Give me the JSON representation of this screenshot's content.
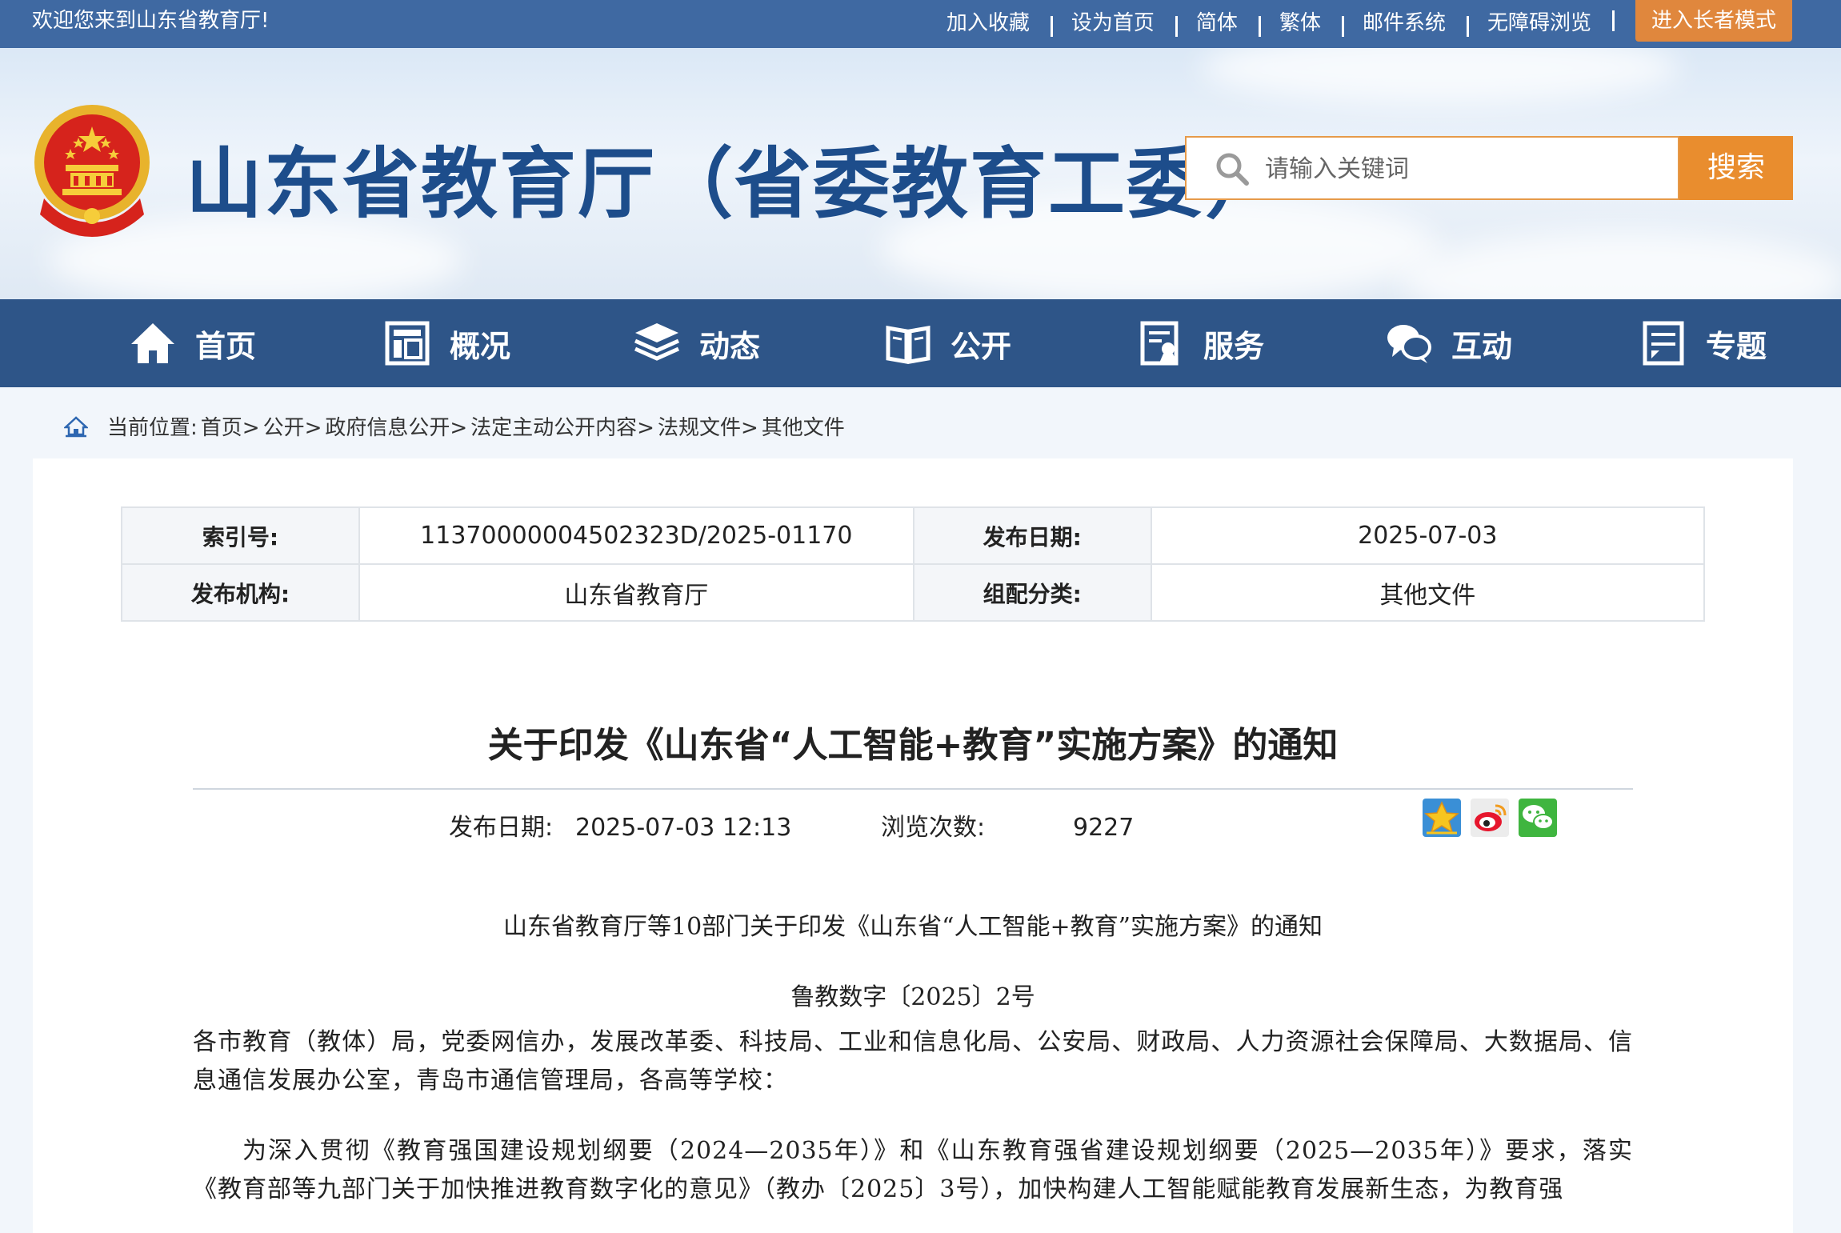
{
  "topbar": {
    "welcome": "欢迎您来到山东省教育厅!",
    "links": [
      "加入收藏",
      "设为首页",
      "简体",
      "繁体",
      "邮件系统",
      "无障碍浏览"
    ],
    "elder_mode": "进入长者模式"
  },
  "header": {
    "site_title": "山东省教育厅（省委教育工委）",
    "emblem_icon": "national-emblem-icon",
    "search": {
      "placeholder": "请输入关键词",
      "button": "搜索"
    }
  },
  "nav": {
    "items": [
      {
        "label": "首页",
        "icon": "home-icon"
      },
      {
        "label": "概况",
        "icon": "overview-icon"
      },
      {
        "label": "动态",
        "icon": "news-stack-icon"
      },
      {
        "label": "公开",
        "icon": "open-book-icon"
      },
      {
        "label": "服务",
        "icon": "service-form-icon"
      },
      {
        "label": "互动",
        "icon": "chat-bubbles-icon"
      },
      {
        "label": "专题",
        "icon": "topic-doc-icon"
      }
    ]
  },
  "breadcrumb": {
    "prefix": "当前位置:",
    "items": [
      "首页>",
      "公开>",
      "政府信息公开>",
      "法定主动公开内容>",
      "法规文件>",
      "其他文件"
    ]
  },
  "meta": {
    "index_label": "索引号:",
    "index_value": "11370000004502323D/2025-01170",
    "date_label": "发布日期:",
    "date_value": "2025-07-03",
    "org_label": "发布机构:",
    "org_value": "山东省教育厅",
    "category_label": "组配分类:",
    "category_value": "其他文件"
  },
  "article": {
    "title": "关于印发《山东省“人工智能+教育”实施方案》的通知",
    "publish_label": "发布日期:",
    "publish_value": "2025-07-03 12:13",
    "views_label": "浏览次数:",
    "views_value": "9227",
    "share_icons": [
      "favorite-star-icon",
      "weibo-icon",
      "wechat-icon"
    ],
    "doc_title": "山东省教育厅等10部门关于印发《山东省“人工智能+教育”实施方案》的通知",
    "doc_number": "鲁教数字〔2025〕2号",
    "recipients": "各市教育（教体）局，党委网信办，发展改革委、科技局、工业和信息化局、公安局、财政局、人力资源社会保障局、大数据局、信息通信发展办公室，青岛市通信管理局，各高等学校：",
    "body_1": "为深入贯彻《教育强国建设规划纲要（2024—2035年）》和《山东教育强省建设规划纲要（2025—2035年）》要求，落实《教育部等九部门关于加快推进教育数字化的意见》（教办〔2025〕3号），加快构建人工智能赋能教育发展新生态，为教育强"
  },
  "colors": {
    "topbar": "#3f69a2",
    "nav": "#2e5588",
    "title_blue": "#1d4d8b",
    "accent_orange": "#e98d2e"
  }
}
